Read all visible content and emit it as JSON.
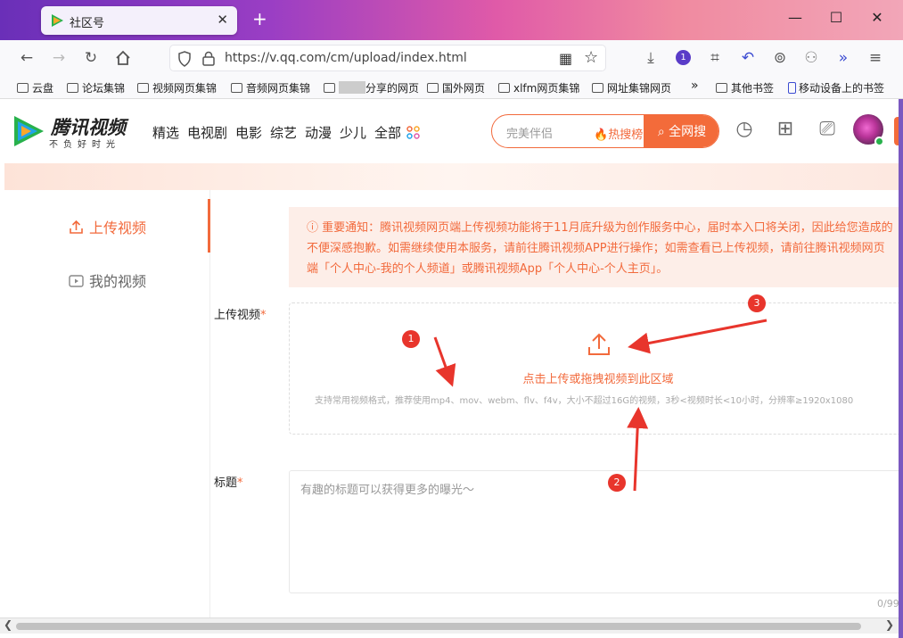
{
  "browser": {
    "tab_title": "社区号",
    "tab_close": "✕",
    "new_tab": "+",
    "url": "https://v.qq.com/cm/upload/index.html",
    "extension_badge": "1",
    "bookmarks": [
      "云盘",
      "论坛集锦",
      "视频网页集锦",
      "音频网页集锦",
      "分享的网页",
      "国外网页",
      "xlfm网页集锦",
      "网址集锦网页"
    ],
    "bookmarks_overflow": "»",
    "other_bookmarks": "其他书签",
    "mobile_bookmarks": "移动设备上的书签"
  },
  "header": {
    "logo_text": "腾讯视频",
    "logo_slogan": "不负好时光",
    "nav": [
      "精选",
      "电视剧",
      "电影",
      "综艺",
      "动漫",
      "少儿",
      "全部"
    ],
    "search_placeholder": "完美伴侣",
    "hot_label": "热搜榜",
    "search_button": "全网搜"
  },
  "sidebar": {
    "items": [
      {
        "label": "上传视频",
        "active": true
      },
      {
        "label": "我的视频",
        "active": false
      }
    ]
  },
  "main": {
    "notice": "ⓘ 重要通知：腾讯视频网页端上传视频功能将于11月底升级为创作服务中心，届时本入口将关闭，因此给您造成的不便深感抱歉。如需继续使用本服务，请前往腾讯视频APP进行操作；如需查看已上传视频，请前往腾讯视频网页端「个人中心-我的个人频道」或腾讯视频App「个人中心-个人主页」。",
    "upload_label": "上传视频",
    "upload_tip": "点击上传或拖拽视频到此区域",
    "upload_sub": "支持常用视频格式，推荐使用mp4、mov、webm、flv、f4v，大小不超过16G的视频，3秒<视频时长<10小时，分辨率≥1920x1080",
    "title_label": "标题",
    "title_placeholder": "有趣的标题可以获得更多的曝光～",
    "counter": "0/99",
    "required_mark": "*"
  },
  "annotations": [
    "1",
    "2",
    "3"
  ],
  "colors": {
    "accent": "#f36b3a",
    "marker": "#e8352c"
  }
}
